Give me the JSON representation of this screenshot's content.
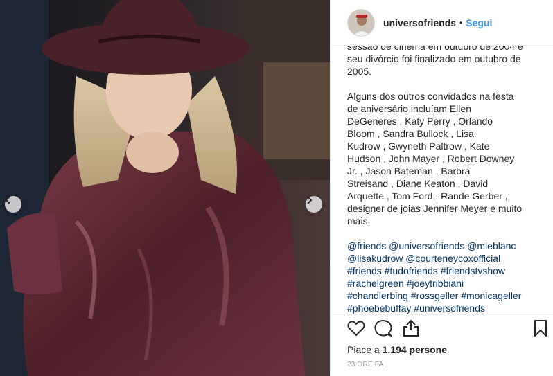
{
  "post": {
    "photo_alt": "",
    "nav": {
      "prev": "‹",
      "next": "›"
    }
  },
  "header": {
    "username": "universofriends",
    "separator": "•",
    "follow_label": "Segui"
  },
  "caption": {
    "paragraph_1": "sessão de cinema em outubro de 2004 e\nseu divórcio foi finalizado em outubro de\n2005.",
    "paragraph_2": "Alguns dos outros convidados na festa\nde aniversário incluíam Ellen\nDeGeneres , Katy Perry , Orlando\nBloom , Sandra Bullock , Lisa\nKudrow , Gwyneth Paltrow , Kate\nHudson , John Mayer , Robert Downey\nJr. , Jason Bateman , Barbra\nStreisand , Diane Keaton , David\nArquette , Tom Ford , Rande Gerber ,\ndesigner de joias Jennifer Meyer e muito\nmais.",
    "hashtags": [
      [
        "@friends",
        "@universofriends",
        "@mleblanc"
      ],
      [
        "@lisakudrow",
        "@courteneycoxofficial"
      ],
      [
        "#friends",
        "#tudofriends",
        "#friendstvshow"
      ],
      [
        "#rachelgreen",
        "#joeytribbiani"
      ],
      [
        "#chandlerbing",
        "#rossgeller",
        "#monicageller"
      ],
      [
        "#phoebebuffay",
        "#universofriends"
      ]
    ]
  },
  "actions": {
    "icons": [
      "heart-icon",
      "comment-icon",
      "share-icon",
      "bookmark-icon"
    ],
    "likes_prefix": "Piace a",
    "likes_count": "1.194",
    "likes_suffix": "persone",
    "timestamp": "23 ORE FA"
  },
  "colors": {
    "accent": "#3897f0",
    "hashtag": "#003569",
    "text": "#262626",
    "muted": "#999999",
    "coat": "#5a2a33",
    "hat": "#4a2129"
  }
}
